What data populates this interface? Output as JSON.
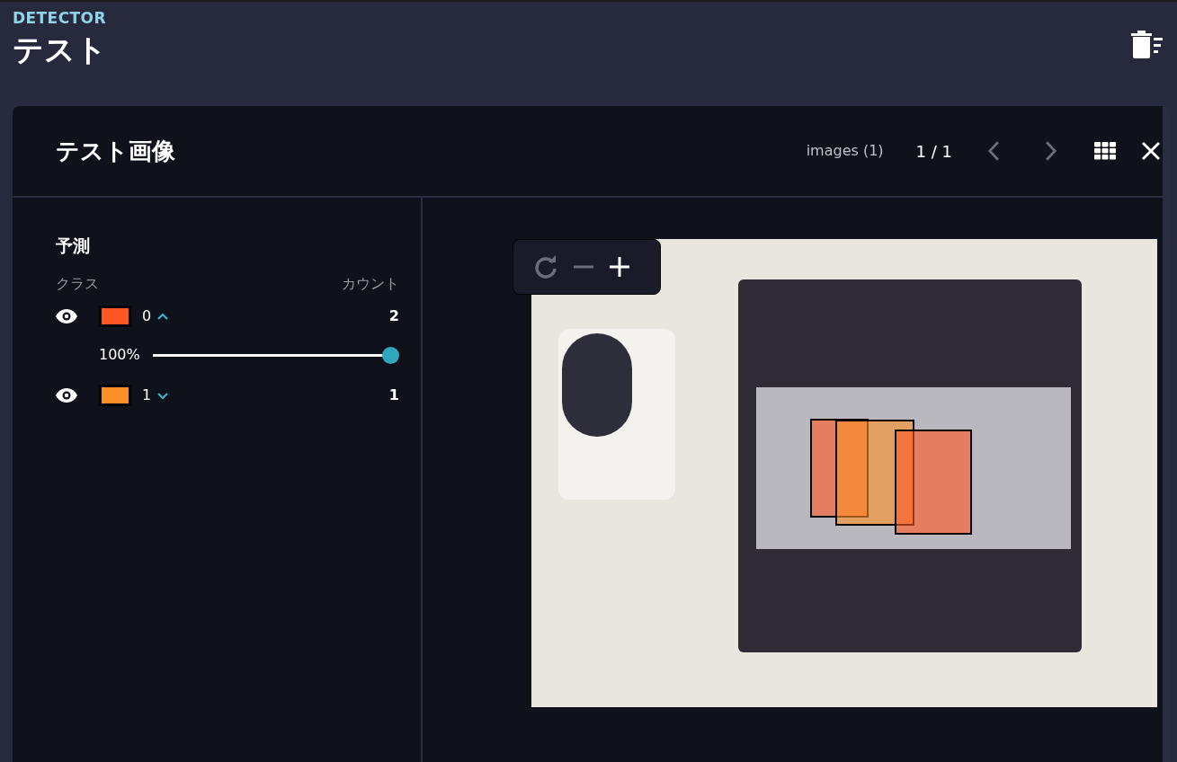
{
  "header": {
    "eyebrow": "DETECTOR",
    "title": "テスト"
  },
  "panel": {
    "title": "テスト画像",
    "images_label": "images (1)",
    "pager": "1 / 1",
    "prev_disabled": true,
    "next_disabled": true
  },
  "predictions": {
    "title": "予測",
    "class_heading": "クラス",
    "count_heading": "カウント",
    "classes": [
      {
        "name": "0",
        "color": "#ff5722",
        "visible": true,
        "expanded": true,
        "count": "2",
        "opacity_label": "100%",
        "level": 1
      },
      {
        "name": "1",
        "color": "#ff8f26",
        "visible": true,
        "expanded": false,
        "count": "1"
      }
    ]
  },
  "zoom_controls": {
    "reset_disabled": true,
    "zoom_out_disabled": true,
    "zoom_in_disabled": false
  }
}
